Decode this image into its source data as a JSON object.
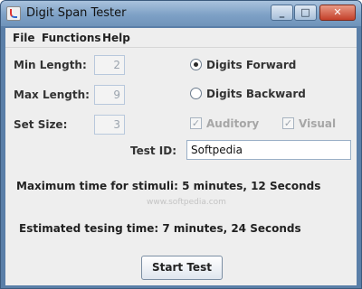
{
  "window": {
    "title": "Digit Span Tester"
  },
  "titlebar_buttons": {
    "minimize": "_",
    "maximize": "□",
    "close": "✕"
  },
  "menu": {
    "items": [
      "File",
      "Functions",
      "Help"
    ]
  },
  "form": {
    "min_length": {
      "label": "Min Length:",
      "value": "2"
    },
    "max_length": {
      "label": "Max Length:",
      "value": "9"
    },
    "set_size": {
      "label": "Set Size:",
      "value": "3"
    },
    "digits_forward": {
      "label": "Digits Forward",
      "selected": true
    },
    "digits_backward": {
      "label": "Digits Backward",
      "selected": false
    },
    "auditory": {
      "label": "Auditory",
      "checked": true
    },
    "visual": {
      "label": "Visual",
      "checked": true
    },
    "test_id": {
      "label": "Test ID:",
      "value": "Softpedia"
    }
  },
  "info": {
    "max_time": "Maximum time for stimuli: 5 minutes, 12 Seconds",
    "est_time": "Estimated tesing time: 7 minutes, 24 Seconds"
  },
  "watermark": "www.softpedia.com",
  "actions": {
    "start_label": "Start Test"
  },
  "icons": {
    "app": "java-app-icon",
    "radio_on": "radio-selected-icon",
    "check": "checkmark-icon"
  }
}
